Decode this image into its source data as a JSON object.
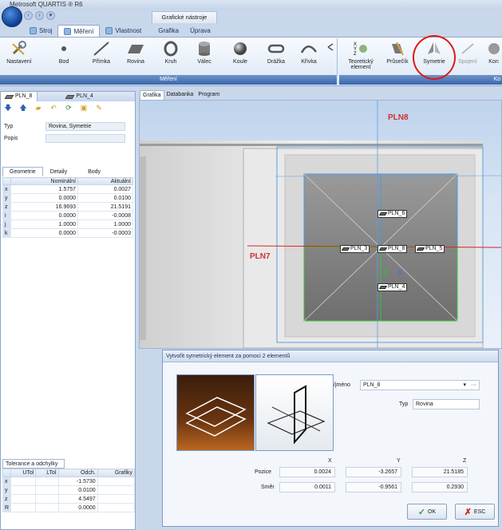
{
  "app": {
    "title": "Metrosoft QUARTIS ® R6",
    "context_tab": "Grafické nástroje"
  },
  "ribbon_tabs": [
    {
      "label": "Stroj"
    },
    {
      "label": "Měření"
    },
    {
      "label": "Vlastnost"
    },
    {
      "label": "Grafika"
    },
    {
      "label": "Úprava"
    }
  ],
  "ribbon_buttons": [
    {
      "label": "Nastavení",
      "icon": "wrench-icon"
    },
    {
      "label": "Bod",
      "icon": "point-icon"
    },
    {
      "label": "Přímka",
      "icon": "line-icon"
    },
    {
      "label": "Rovina",
      "icon": "plane-icon"
    },
    {
      "label": "Kruh",
      "icon": "circle-icon"
    },
    {
      "label": "Válec",
      "icon": "cylinder-icon"
    },
    {
      "label": "Koule",
      "icon": "sphere-icon"
    },
    {
      "label": "Drážka",
      "icon": "slot-icon"
    },
    {
      "label": "Křivka",
      "icon": "curve-icon"
    }
  ],
  "ribbon_buttons2": [
    {
      "label": "Teoretický element",
      "icon": "xyz-icon"
    },
    {
      "label": "Průsečík",
      "icon": "intersection-icon"
    },
    {
      "label": "Symetrie",
      "icon": "symmetry-icon"
    },
    {
      "label": "Spojení",
      "icon": "connect-icon"
    },
    {
      "label": "Kon",
      "icon": "construct-icon"
    }
  ],
  "ribbon_groups": {
    "group1": "Měření",
    "group2": "Ko"
  },
  "left_panel": {
    "tabs": [
      "PLN_8",
      "PLN_4"
    ],
    "typ_label": "Typ",
    "typ_value": "Rovina, Symetrie",
    "popis_label": "Popis",
    "popis_value": "",
    "subtabs": [
      "Geometrie",
      "Detaily",
      "Body"
    ],
    "geo_headers": [
      "Nominální",
      "Aktuální"
    ],
    "geo_rows": [
      {
        "k": "x",
        "nom": "1.5757",
        "act": "0.0027"
      },
      {
        "k": "y",
        "nom": "0.0000",
        "act": "0.0100"
      },
      {
        "k": "z",
        "nom": "16.9693",
        "act": "21.5191"
      },
      {
        "k": "i",
        "nom": "0.0000",
        "act": "-0.0008"
      },
      {
        "k": "j",
        "nom": "1.0000",
        "act": "1.0000"
      },
      {
        "k": "k",
        "nom": "0.0000",
        "act": "-0.0003"
      }
    ],
    "tol_tab": "Tolerance a odchylky",
    "tol_headers": [
      "UTol",
      "LTol",
      "Odch.",
      "Grafiky"
    ],
    "tol_rows": [
      {
        "k": "x",
        "odch": "-1.5730"
      },
      {
        "k": "y",
        "odch": "0.0100"
      },
      {
        "k": "z",
        "odch": "4.5497"
      },
      {
        "k": "R",
        "odch": "0.0000"
      }
    ]
  },
  "graphics_tabs": [
    "Grafika",
    "Databanka",
    "Program"
  ],
  "viewport": {
    "labels": {
      "pln8": "PLN8",
      "pln7": "PLN7"
    },
    "boxes": [
      "PLN_6",
      "PLN_3",
      "PLN_8",
      "PLN_5",
      "PLN_4"
    ],
    "axes": {
      "z": "Z",
      "x": "X"
    }
  },
  "dialog": {
    "title": "Vytvořit symetrický element za pomoci 2 elementů",
    "name_label": "/jméno",
    "name_value": "PLN_8",
    "typ_label": "Typ",
    "typ_value": "Rovina",
    "col_x": "X",
    "col_y": "Y",
    "col_z": "Z",
    "pozice_label": "Pozice",
    "pozice": [
      "0.0024",
      "-3.2657",
      "21.5185"
    ],
    "smer_label": "Směr",
    "smer": [
      "0.0011",
      "-0.9561",
      "0.2930"
    ],
    "ok_label": "OK",
    "esc_label": "ESC"
  },
  "colors": {
    "highlight": "#e01818",
    "ribbon_group": "#3a67ab",
    "label_red": "#d23030"
  }
}
